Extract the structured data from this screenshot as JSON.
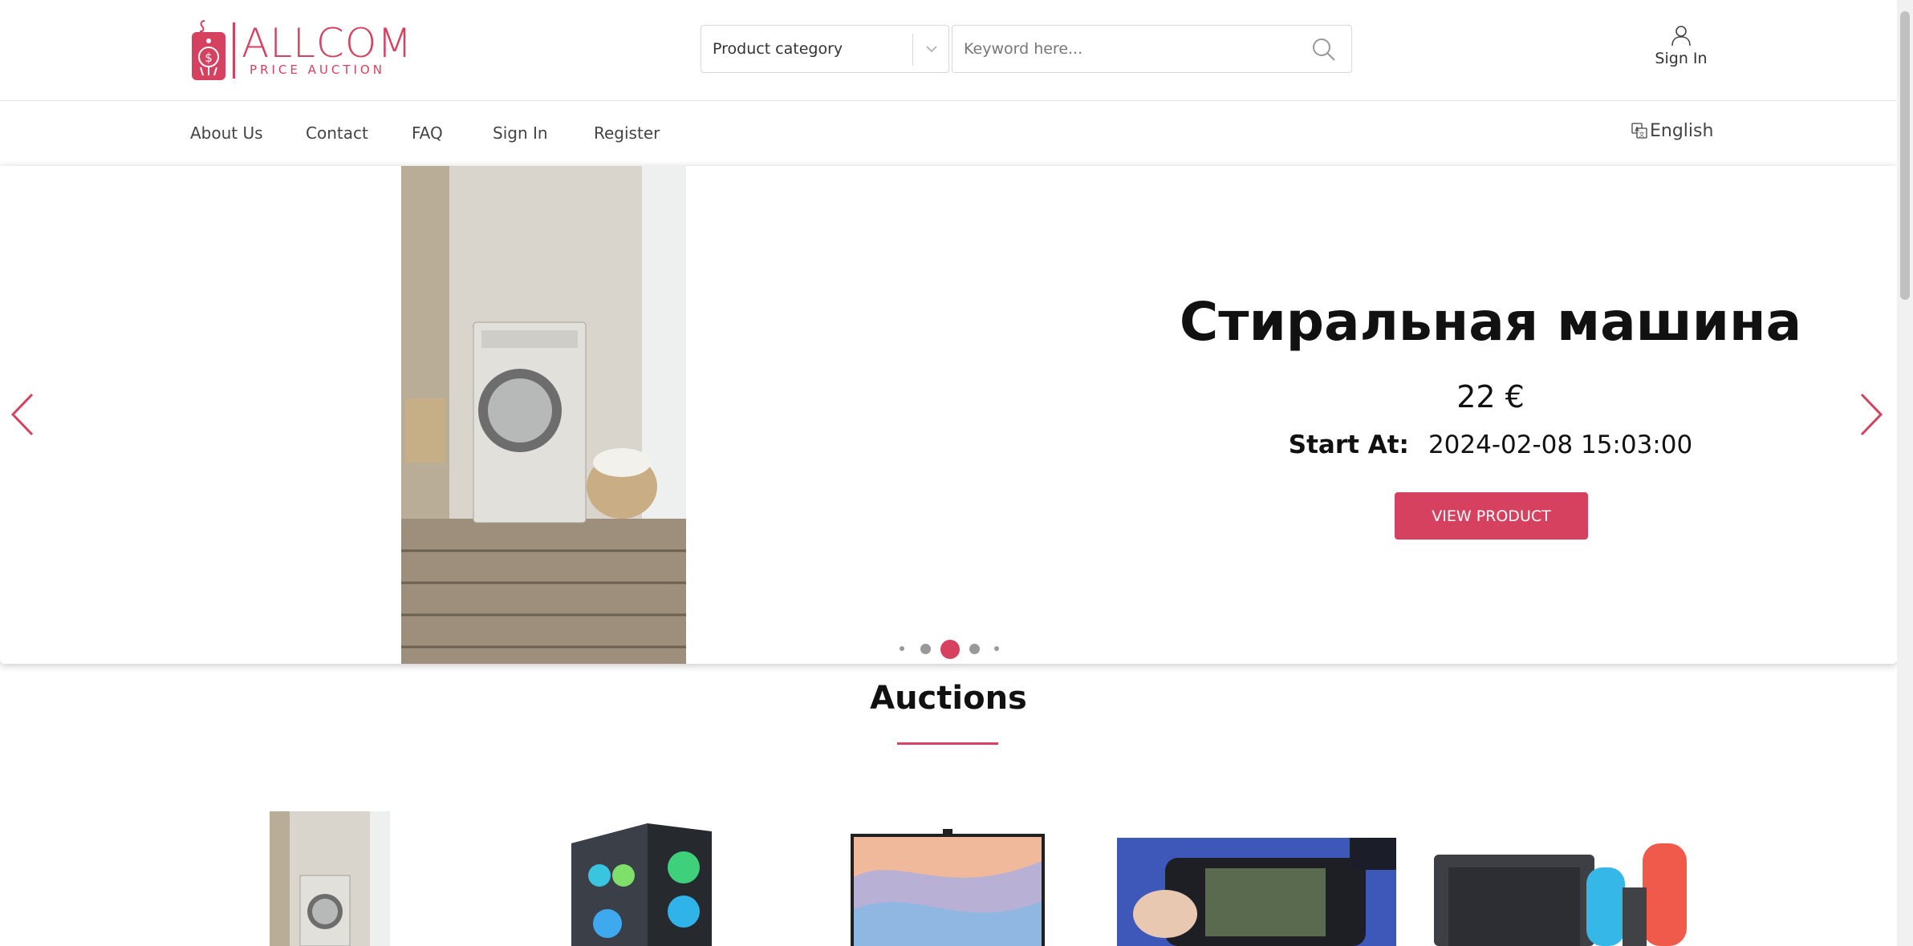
{
  "brand": {
    "name": "ALLCOM",
    "tagline": "PRICE AUCTION",
    "accent_color": "#d6415f"
  },
  "header": {
    "category_select": {
      "selected": "Product category",
      "icon": "chevron-down-icon"
    },
    "search": {
      "placeholder": "Keyword here...",
      "value": "",
      "icon": "search-icon"
    },
    "signin": {
      "label": "Sign In",
      "icon": "user-icon"
    }
  },
  "nav": {
    "items": [
      {
        "label": "About Us"
      },
      {
        "label": "Contact"
      },
      {
        "label": "FAQ"
      },
      {
        "label": "Sign In"
      },
      {
        "label": "Register"
      }
    ],
    "language": {
      "label": "English",
      "icon": "translate-icon"
    }
  },
  "hero": {
    "title": "Стиральная машина",
    "price": "22 €",
    "start_label": "Start At:",
    "start_value": "2024-02-08 15:03:00",
    "button_label": "VIEW PRODUCT",
    "image": "washing-machine-photo",
    "prev_icon": "chevron-left-icon",
    "next_icon": "chevron-right-icon",
    "slides": 5,
    "active_slide": 3
  },
  "auctions": {
    "title": "Auctions",
    "items": [
      {
        "image": "washing-machine-thumbnail"
      },
      {
        "image": "gaming-pc-thumbnail"
      },
      {
        "image": "monitor-thumbnail"
      },
      {
        "image": "handheld-console-thumbnail"
      },
      {
        "image": "nintendo-switch-thumbnail"
      }
    ]
  }
}
